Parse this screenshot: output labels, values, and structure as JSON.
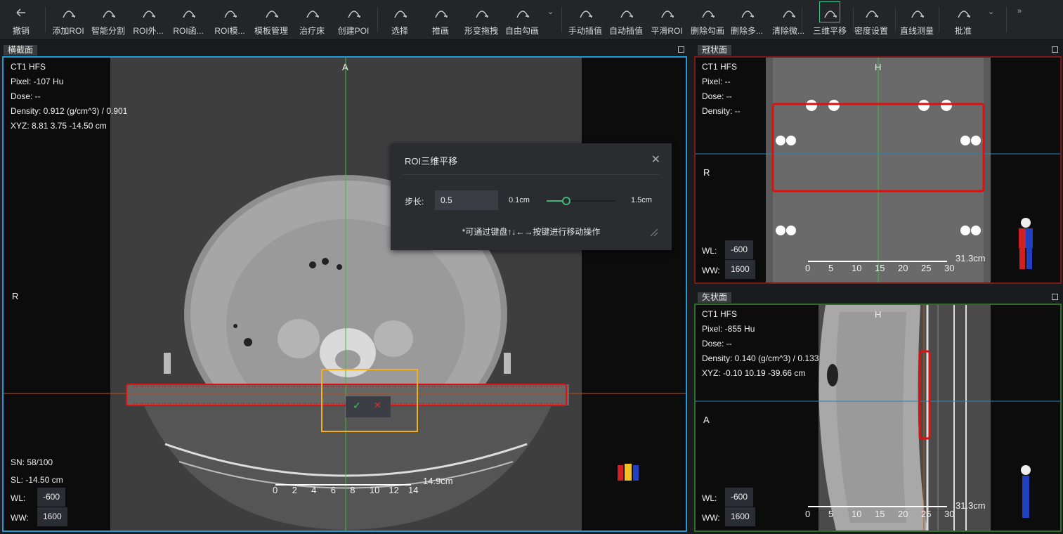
{
  "toolbar": {
    "items": [
      {
        "label": "撤销",
        "icon": "undo-icon"
      },
      {
        "label": "添加ROI",
        "icon": "add-roi-icon"
      },
      {
        "label": "智能分割",
        "icon": "smart-segment-icon"
      },
      {
        "label": "ROI外...",
        "icon": "roi-outer-icon"
      },
      {
        "label": "ROI函...",
        "icon": "roi-function-icon"
      },
      {
        "label": "ROI模...",
        "icon": "roi-template-icon"
      },
      {
        "label": "模板管理",
        "icon": "template-manage-icon"
      },
      {
        "label": "治疗床",
        "icon": "couch-icon"
      },
      {
        "label": "创建POI",
        "icon": "create-poi-icon"
      },
      {
        "label": "选择",
        "icon": "select-cursor-icon"
      },
      {
        "label": "推画",
        "icon": "push-draw-icon"
      },
      {
        "label": "形变拖拽",
        "icon": "deform-drag-icon"
      },
      {
        "label": "自由勾画",
        "icon": "free-draw-icon"
      },
      {
        "label": "手动插值",
        "icon": "manual-interp-icon"
      },
      {
        "label": "自动插值",
        "icon": "auto-interp-icon"
      },
      {
        "label": "平滑ROI",
        "icon": "smooth-roi-icon"
      },
      {
        "label": "删除勾画",
        "icon": "delete-contour-icon"
      },
      {
        "label": "删除多...",
        "icon": "delete-multi-icon"
      },
      {
        "label": "清除微...",
        "icon": "clear-small-icon"
      },
      {
        "label": "三维平移",
        "icon": "3d-translate-icon"
      },
      {
        "label": "密度设置",
        "icon": "density-icon"
      },
      {
        "label": "直线测量",
        "icon": "ruler-icon"
      },
      {
        "label": "批准",
        "icon": "approve-lock-icon"
      }
    ]
  },
  "axial": {
    "tab": "横截面",
    "series": "CT1 HFS",
    "pixel": "Pixel:  -107 Hu",
    "dose": "Dose:  --",
    "density": "Density:  0.912 (g/cm^3) / 0.901",
    "xyz": "XYZ: 8.81 3.75 -14.50 cm",
    "top_orient": "A",
    "left_orient": "R",
    "sn": "SN: 58/100",
    "sl": "SL: -14.50 cm",
    "wl_label": "WL:",
    "wl": "-600",
    "ww_label": "WW:",
    "ww": "1600",
    "scale_ticks": [
      "0",
      "2",
      "4",
      "6",
      "8",
      "10",
      "12",
      "14"
    ],
    "scale_len": "14.9cm",
    "confirm": "✓",
    "cancel": "✕"
  },
  "coronal": {
    "tab": "冠状面",
    "series": "CT1 HFS",
    "pixel": "Pixel:  --",
    "dose": "Dose:  --",
    "density": "Density:  --",
    "top_orient": "H",
    "left_orient": "R",
    "wl_label": "WL:",
    "wl": "-600",
    "ww_label": "WW:",
    "ww": "1600",
    "scale_ticks": [
      "0",
      "5",
      "10",
      "15",
      "20",
      "25",
      "30"
    ],
    "scale_len": "31.3cm"
  },
  "sagittal": {
    "tab": "矢状面",
    "series": "CT1 HFS",
    "pixel": "Pixel:  -855 Hu",
    "dose": "Dose:  --",
    "density": "Density:  0.140 (g/cm^3) / 0.133",
    "xyz": "XYZ: -0.10 10.19 -39.66 cm",
    "top_orient": "H",
    "left_orient": "A",
    "wl_label": "WL:",
    "wl": "-600",
    "ww_label": "WW:",
    "ww": "1600",
    "scale_ticks": [
      "0",
      "5",
      "10",
      "15",
      "20",
      "25",
      "30"
    ],
    "scale_len": "31.3cm"
  },
  "dialog": {
    "title": "ROI三维平移",
    "step_label": "步长:",
    "step_value": "0.5",
    "min_label": "0.1cm",
    "max_label": "1.5cm",
    "slider_fraction": 0.29,
    "hint": "*可通过键盘↑↓←→按键进行移动操作"
  },
  "colors": {
    "axial_border": "#1f9ad6",
    "coronal_border": "#7a1a14",
    "sagittal_border": "#2f6d2a",
    "roi": "#e01010",
    "crosshair_green": "#42b843",
    "crosshair_blue": "#2a86b8",
    "crosshair_orange": "#c0501a",
    "selection": "#f2b01e"
  }
}
